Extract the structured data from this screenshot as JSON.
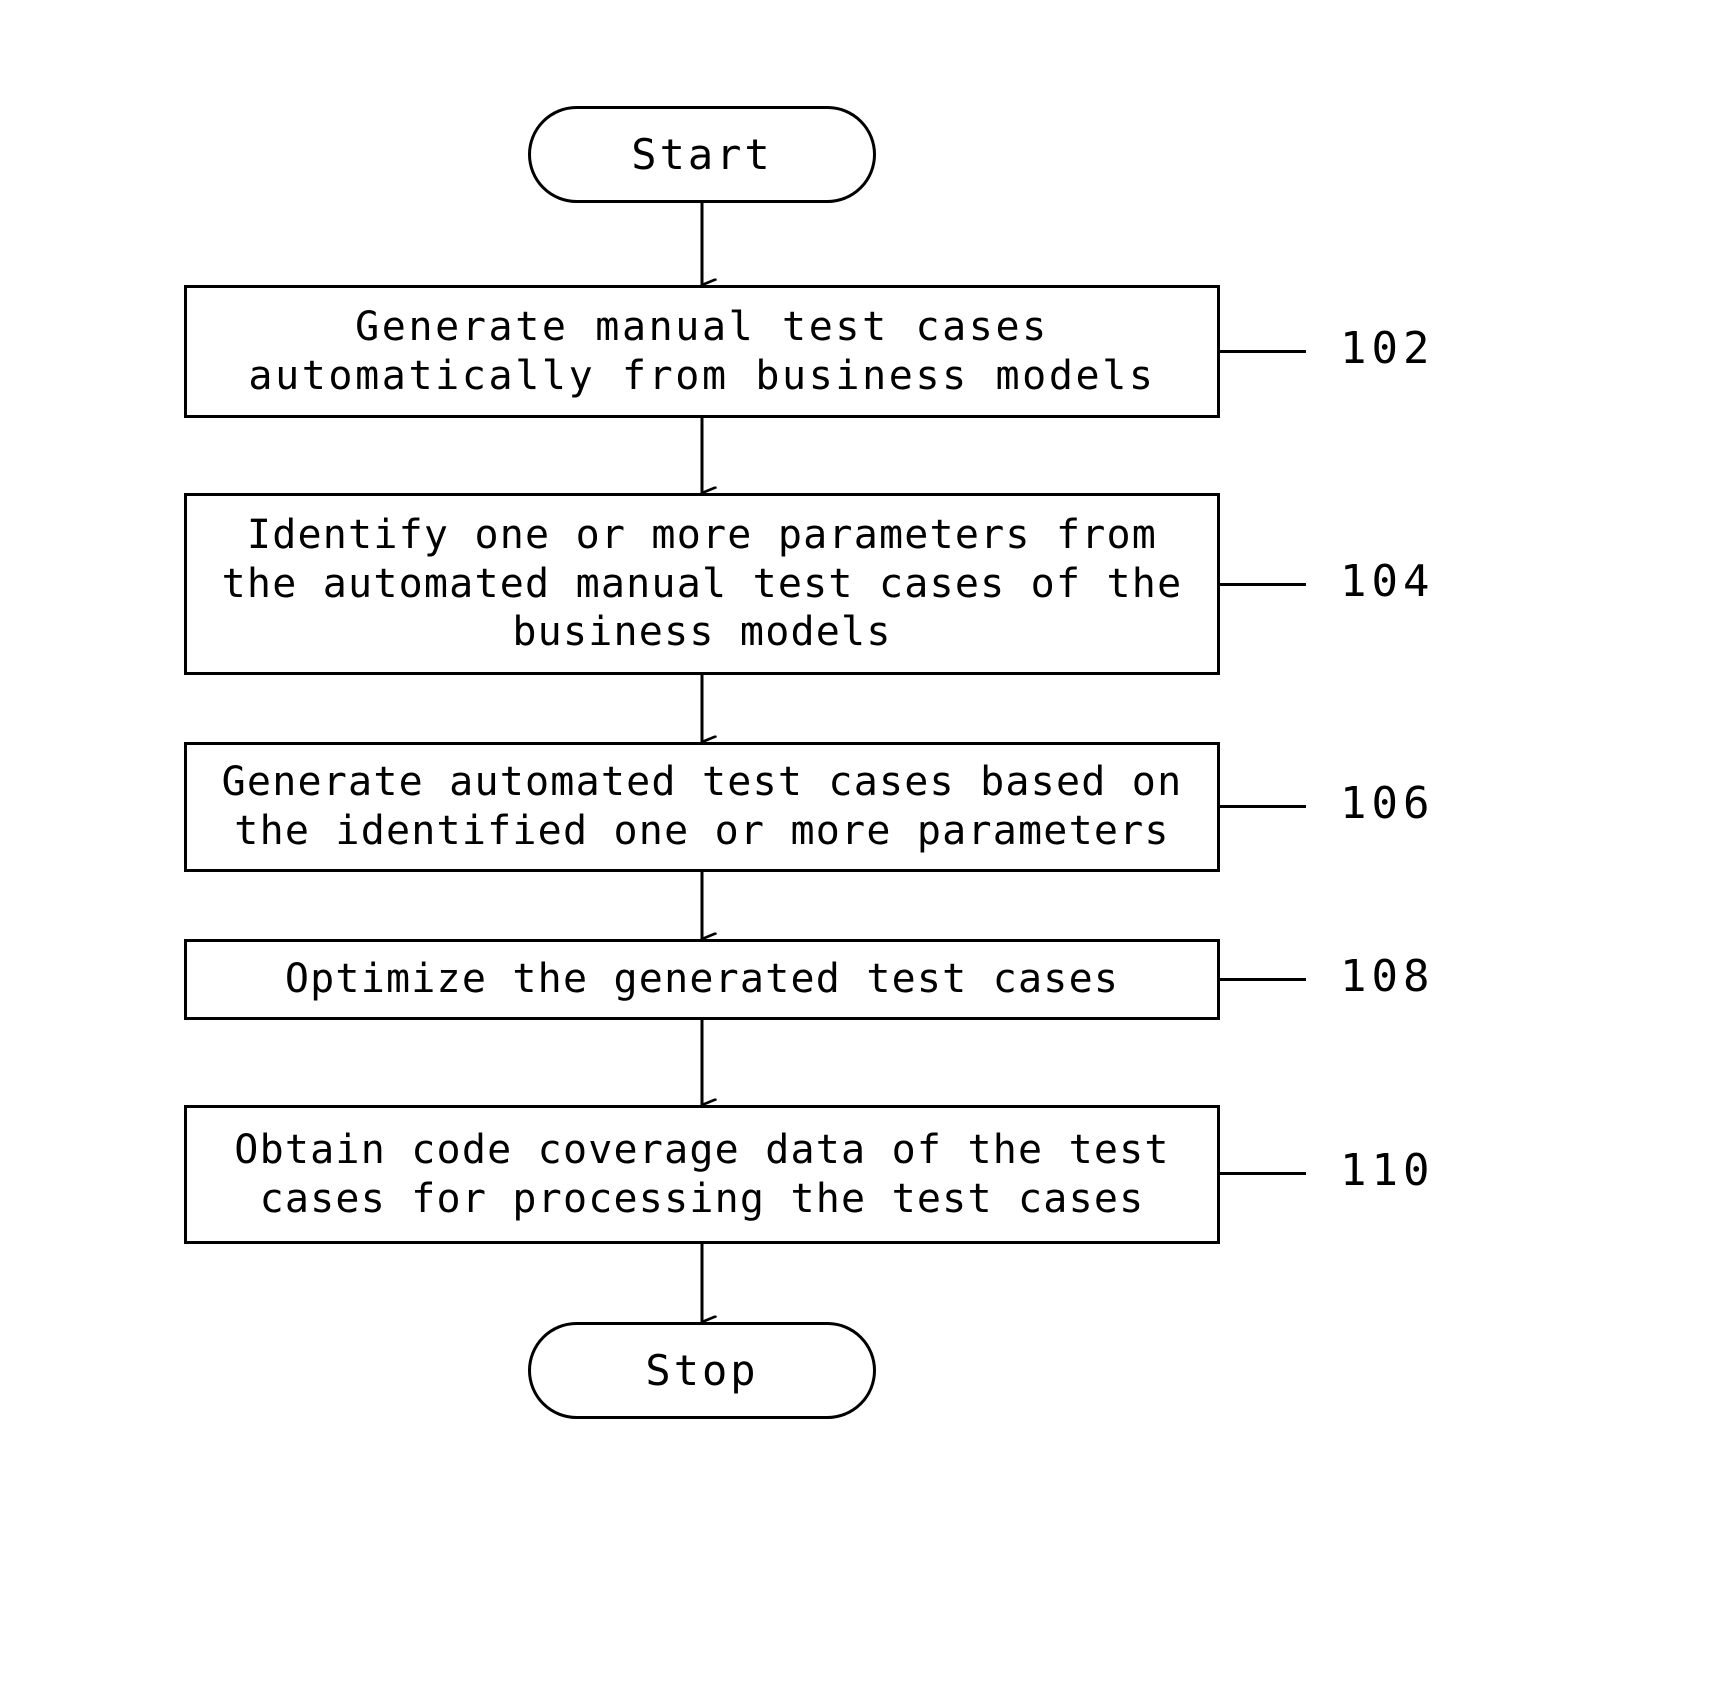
{
  "figure": {
    "type": "flowchart",
    "orientation": "vertical",
    "background_color": "#ffffff",
    "line_color": "#000000"
  },
  "nodes": {
    "start": {
      "label": "Start",
      "shape": "terminator"
    },
    "stop": {
      "label": "Stop",
      "shape": "terminator"
    },
    "step_102": {
      "shape": "process",
      "ref": "102",
      "label": "Generate  manual test  cases\nautomatically from business models"
    },
    "step_104": {
      "shape": "process",
      "ref": "104",
      "label": "Identify one or more parameters from\nthe automated manual test cases of the\nbusiness models"
    },
    "step_106": {
      "shape": "process",
      "ref": "106",
      "label": "Generate automated test cases based on\nthe identified one or more parameters"
    },
    "step_108": {
      "shape": "process",
      "ref": "108",
      "label": "Optimize the generated test cases"
    },
    "step_110": {
      "shape": "process",
      "ref": "110",
      "label": "Obtain code coverage data of the test\ncases for processing the test cases"
    }
  },
  "edges": [
    {
      "from": "start",
      "to": "step_102",
      "arrow": "down"
    },
    {
      "from": "step_102",
      "to": "step_104",
      "arrow": "down"
    },
    {
      "from": "step_104",
      "to": "step_106",
      "arrow": "down"
    },
    {
      "from": "step_106",
      "to": "step_108",
      "arrow": "down"
    },
    {
      "from": "step_108",
      "to": "step_110",
      "arrow": "down"
    },
    {
      "from": "step_110",
      "to": "stop",
      "arrow": "down"
    }
  ]
}
